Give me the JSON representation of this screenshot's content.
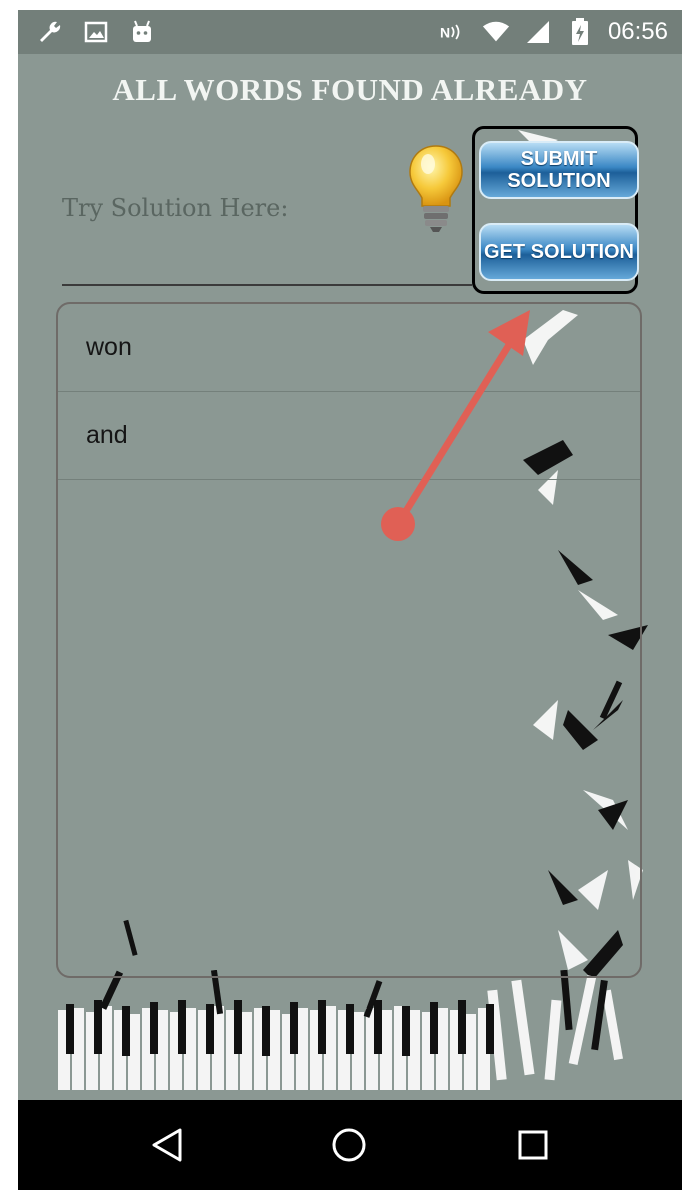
{
  "status_bar": {
    "time": "06:56",
    "icons": [
      "wrench-icon",
      "image-icon",
      "android-icon",
      "nfc-icon",
      "wifi-icon",
      "signal-icon",
      "battery-charging-icon"
    ]
  },
  "header": {
    "title": "ALL WORDS FOUND ALREADY"
  },
  "solution": {
    "label": "Try Solution Here:",
    "input_value": "",
    "hint_icon": "lightbulb-icon",
    "submit_label_line1": "SUBMIT",
    "submit_label_line2": "SOLUTION",
    "get_label": "GET SOLUTION"
  },
  "words": [
    {
      "text": "won"
    },
    {
      "text": "and"
    }
  ],
  "annotation": {
    "arrow_color": "#e06055",
    "highlight_color": "#000000"
  },
  "nav": {
    "icons": [
      "back-icon",
      "home-icon",
      "recents-icon"
    ]
  },
  "colors": {
    "background": "#8b9893",
    "button_blue": "#2f78b8",
    "nav_bar": "#000000"
  }
}
